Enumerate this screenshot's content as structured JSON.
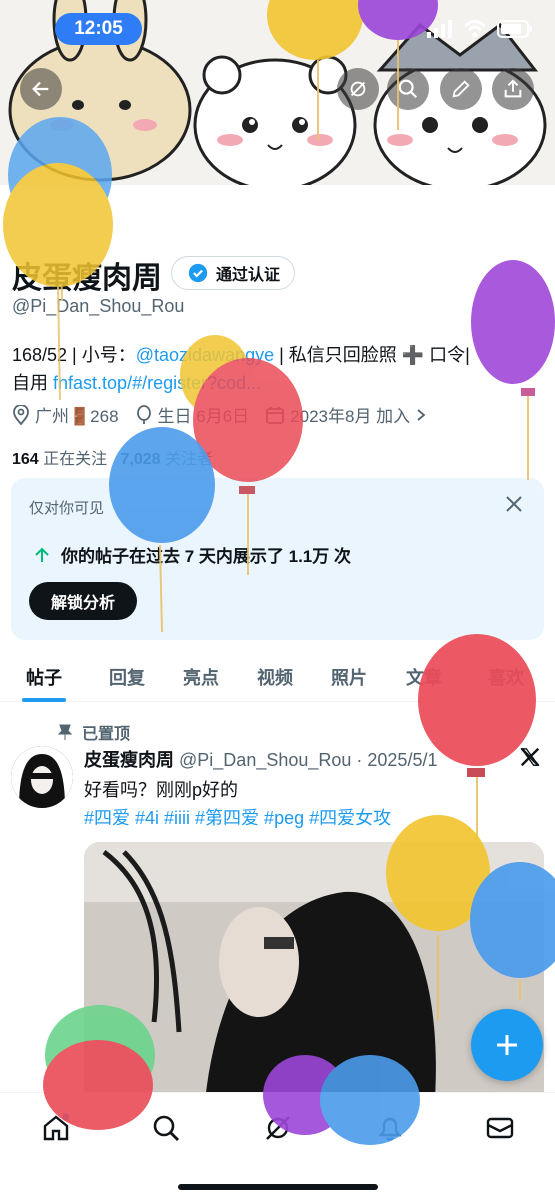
{
  "status_bar": {
    "time": "12:05"
  },
  "profile": {
    "name": "皮蛋瘦肉周",
    "verified_label": "通过认证",
    "handle": "@Pi_Dan_Shou_Rou",
    "bio_line1_prefix": "168/52 | 小号：",
    "bio_line1_link": "@taozidawangye",
    "bio_line1_suffix": " | 私信只回脸照 ➕ 口令|",
    "bio_line2_prefix": "自用 ",
    "bio_line2_link": "fnfast.top/#/register?cod...",
    "location": "广州🚪268",
    "birthday": "生日 6月6日",
    "joined": "2023年8月 加入",
    "following_count": "164",
    "following_label": "正在关注",
    "followers_count": "7,028",
    "followers_label": "关注者"
  },
  "insight_card": {
    "only_you": "仅对你可见",
    "stat_text": "你的帖子在过去 7 天内展示了 1.1万 次",
    "unlock_label": "解锁分析"
  },
  "tabs": [
    "帖子",
    "回复",
    "亮点",
    "视频",
    "照片",
    "文章",
    "喜欢"
  ],
  "post": {
    "pinned_label": "已置顶",
    "author": "皮蛋瘦肉周",
    "handle_date": "@Pi_Dan_Shou_Rou · 2025/5/1",
    "text": "好看吗？刚刚p好的",
    "tags": "#四爱 #4i #iiii #第四爱 #peg #四爱女攻"
  },
  "colors": {
    "accent": "#1d9bf0",
    "status_pill": "#2f7df6"
  }
}
